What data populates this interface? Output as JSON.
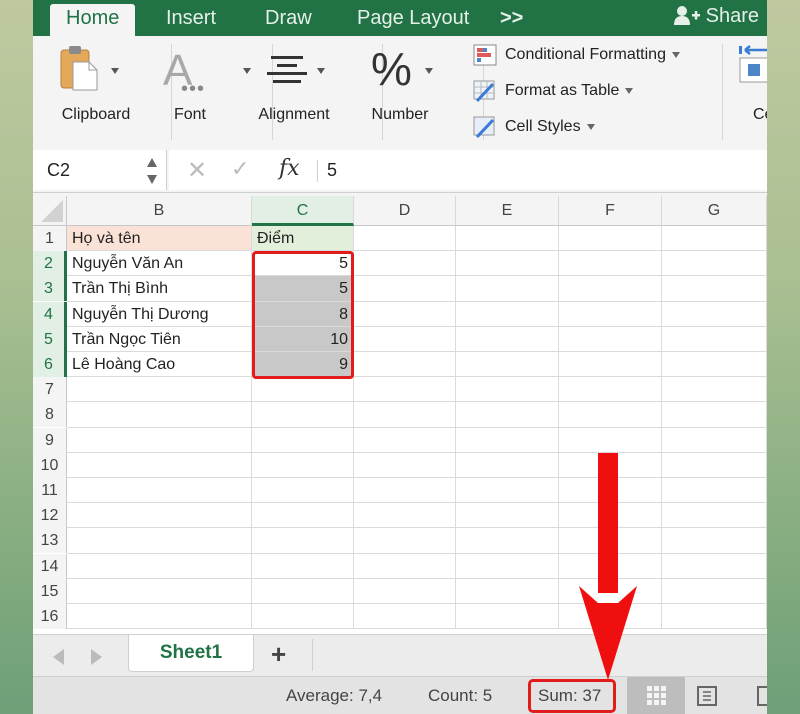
{
  "ribbon": {
    "tabs": [
      {
        "label": "Home",
        "active": true
      },
      {
        "label": "Insert"
      },
      {
        "label": "Draw"
      },
      {
        "label": "Page Layout"
      }
    ],
    "overflow_label": ">>",
    "share_label": "Share",
    "groups": {
      "clipboard": "Clipboard",
      "font": "Font",
      "alignment": "Alignment",
      "number": "Number",
      "cells_partial": "Ce"
    },
    "styles": {
      "conditional_formatting": "Conditional Formatting",
      "format_as_table": "Format as Table",
      "cell_styles": "Cell Styles"
    },
    "icons": {
      "font_glyph": "A",
      "number_glyph": "%"
    }
  },
  "formula_bar": {
    "name_box": "C2",
    "cancel_glyph": "✕",
    "enter_glyph": "✓",
    "fx_label": "fx",
    "value": "5"
  },
  "grid": {
    "columns": [
      "B",
      "C",
      "D",
      "E",
      "F",
      "G"
    ],
    "selected_column": "C",
    "rows": [
      {
        "num": "1",
        "B": "Họ và tên",
        "C": "Điểm"
      },
      {
        "num": "2",
        "B": "Nguyễn Văn An",
        "C": "5"
      },
      {
        "num": "3",
        "B": "Trần Thị Bình",
        "C": "5"
      },
      {
        "num": "4",
        "B": "Nguyễn Thị Dương",
        "C": "8"
      },
      {
        "num": "5",
        "B": "Trần Ngọc Tiên",
        "C": "10"
      },
      {
        "num": "6",
        "B": "Lê Hoàng Cao",
        "C": "9"
      },
      {
        "num": "7"
      },
      {
        "num": "8"
      },
      {
        "num": "9"
      },
      {
        "num": "10"
      },
      {
        "num": "11"
      },
      {
        "num": "12"
      },
      {
        "num": "13"
      },
      {
        "num": "14"
      },
      {
        "num": "15"
      },
      {
        "num": "16"
      }
    ]
  },
  "sheets": {
    "tabs": [
      "Sheet1"
    ],
    "add_label": "+"
  },
  "status_bar": {
    "average": "Average: 7,4",
    "count": "Count: 5",
    "sum": "Sum: 37"
  },
  "colors": {
    "accent": "#217346",
    "highlight_red": "#e21b1b"
  }
}
